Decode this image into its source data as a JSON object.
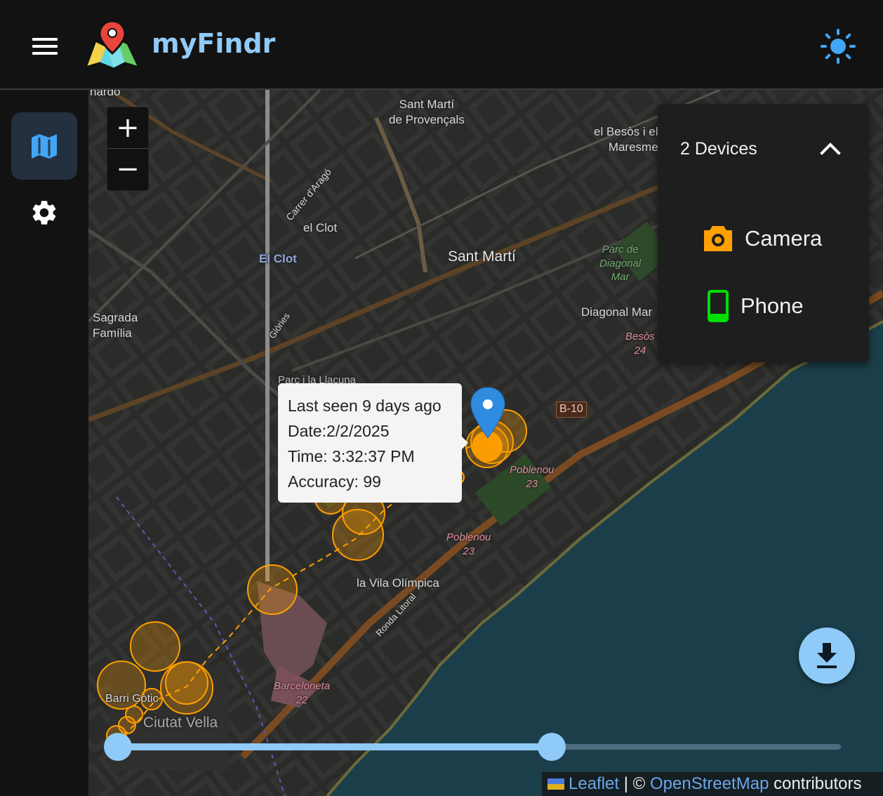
{
  "header": {
    "app_title": "myFindr",
    "menu_icon": "hamburger-menu-icon",
    "theme_icon": "sun-icon",
    "accent_color": "#90caf9"
  },
  "sidebar": {
    "items": [
      {
        "name": "map",
        "icon": "map-icon",
        "active": true
      },
      {
        "name": "settings",
        "icon": "gear-icon",
        "active": false
      }
    ]
  },
  "map": {
    "zoom_in": "+",
    "zoom_out": "−",
    "labels": {
      "nardo": "nardo",
      "sant_marti_provencals": "Sant Martí\nde Provençals",
      "el_besos": "el Besòs i el\nMaresme",
      "carrer_darago": "Carrer d'Aragó",
      "el_clot": "el Clot",
      "el_clot_station": "El Clot",
      "sant_marti": "Sant Martí",
      "parc_diagonal_mar": "Parc de\nDiagonal\nMar",
      "sagrada_familia": "Sagrada\nFamília",
      "diagonal_mar": "Diagonal Mar",
      "besos_24": "Besòs\n24",
      "glories": "Glòries",
      "parc_llacuna": "Parc i la Llacuna\ndel Poblenou",
      "b10": "B-10",
      "poblenou_23a": "Poblenou\n23",
      "poblenou_23b": "Poblenou\n23",
      "vila_olimpica": "la Vila Olímpica",
      "ronda_litoral": "Ronda Litoral",
      "barceloneta": "Barceloneta\n22",
      "barri_gotic": "Barri Gòtic",
      "ciutat_vella": "Ciutat Vella"
    },
    "track_color": "#ff9f00",
    "marker_color": "#2f8be0"
  },
  "popup": {
    "last_seen": "Last seen 9 days ago",
    "date": "Date:2/2/2025",
    "time": "Time: 3:32:37 PM",
    "accuracy": "Accuracy: 99"
  },
  "devices_panel": {
    "title": "2 Devices",
    "chevron_icon": "chevron-up-icon",
    "devices": [
      {
        "name": "Camera",
        "icon": "camera-icon",
        "color": "#ff9f00"
      },
      {
        "name": "Phone",
        "icon": "phone-icon",
        "color": "#00e000"
      }
    ]
  },
  "download_icon": "download-icon",
  "time_slider": {
    "range_start": 0,
    "range_end": 0.6
  },
  "attribution": {
    "leaflet": "Leaflet",
    "separator": " | © ",
    "osm": "OpenStreetMap",
    "contributors": " contributors"
  }
}
